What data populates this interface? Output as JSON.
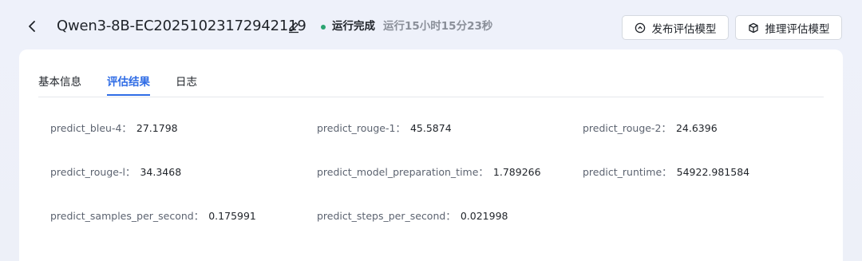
{
  "header": {
    "back_icon": "chevron-left-icon",
    "title": "Qwen3-8B-EC20251023172942119",
    "edit_icon": "pencil-icon",
    "status": {
      "label": "运行完成",
      "duration": "运行15小时15分23秒",
      "color": "#2ba471"
    },
    "buttons": {
      "publish": {
        "label": "发布评估模型",
        "icon": "circle-up-icon"
      },
      "infer": {
        "label": "推理评估模型",
        "icon": "cube-icon"
      }
    }
  },
  "tabs": [
    {
      "label": "基本信息",
      "active": false
    },
    {
      "label": "评估结果",
      "active": true
    },
    {
      "label": "日志",
      "active": false
    }
  ],
  "metrics": [
    {
      "key": "predict_bleu-4：",
      "value": "27.1798"
    },
    {
      "key": "predict_rouge-1：",
      "value": "45.5874"
    },
    {
      "key": "predict_rouge-2：",
      "value": "24.6396"
    },
    {
      "key": "predict_rouge-l：",
      "value": "34.3468"
    },
    {
      "key": "predict_model_preparation_time：",
      "value": "1.789266"
    },
    {
      "key": "predict_runtime：",
      "value": "54922.981584"
    },
    {
      "key": "predict_samples_per_second：",
      "value": "0.175991"
    },
    {
      "key": "predict_steps_per_second：",
      "value": "0.021998"
    }
  ],
  "colors": {
    "accent": "#2f6ce5",
    "success": "#2ba471"
  }
}
